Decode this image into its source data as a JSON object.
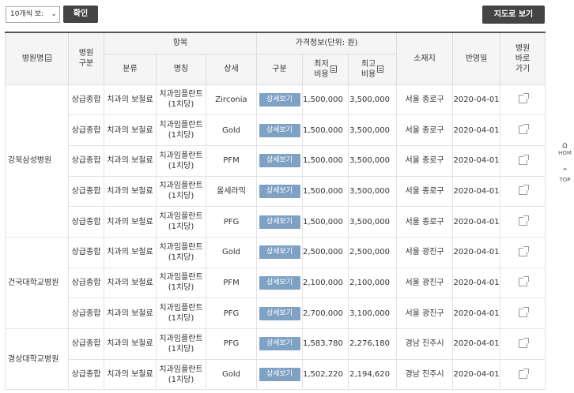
{
  "toolbar": {
    "page_size_value": "10개씩 보:",
    "confirm_label": "확인",
    "map_label": "지도로 보기"
  },
  "headers": {
    "hospital": "병원명",
    "hospital_type": "병원\n구분",
    "item_group": "항목",
    "price_group": "가격정보(단위: 원)",
    "location": "소재지",
    "date": "반영일",
    "shortcut": "병원\n바로\n가기",
    "category": "분류",
    "name": "명칭",
    "detail": "상세",
    "type": "구분",
    "min_cost": "최저\n비용",
    "max_cost": "최고\n비용"
  },
  "hospitals": [
    {
      "name": "강북삼성병원",
      "rows": [
        {
          "type": "상급종합",
          "category": "치과의 보철료",
          "item": "치과임플란트\n(1치당)",
          "detail": "Zirconia",
          "btn": "상세보기",
          "min": "1,500,000",
          "max": "3,500,000",
          "loc": "서울 종로구",
          "date": "2020-04-01"
        },
        {
          "type": "상급종합",
          "category": "치과의 보철료",
          "item": "치과임플란트\n(1치당)",
          "detail": "Gold",
          "btn": "상세보기",
          "min": "1,500,000",
          "max": "3,500,000",
          "loc": "서울 종로구",
          "date": "2020-04-01"
        },
        {
          "type": "상급종합",
          "category": "치과의 보철료",
          "item": "치과임플란트\n(1치당)",
          "detail": "PFM",
          "btn": "상세보기",
          "min": "1,500,000",
          "max": "3,500,000",
          "loc": "서울 종로구",
          "date": "2020-04-01"
        },
        {
          "type": "상급종합",
          "category": "치과의 보철료",
          "item": "치과임플란트\n(1치당)",
          "detail": "올세라믹",
          "btn": "상세보기",
          "min": "1,500,000",
          "max": "3,500,000",
          "loc": "서울 종로구",
          "date": "2020-04-01"
        },
        {
          "type": "상급종합",
          "category": "치과의 보철료",
          "item": "치과임플란트\n(1치당)",
          "detail": "PFG",
          "btn": "상세보기",
          "min": "1,500,000",
          "max": "3,500,000",
          "loc": "서울 종로구",
          "date": "2020-04-01"
        }
      ]
    },
    {
      "name": "건국대학교병원",
      "rows": [
        {
          "type": "상급종합",
          "category": "치과의 보철료",
          "item": "치과임플란트\n(1치당)",
          "detail": "Gold",
          "btn": "상세보기",
          "min": "2,500,000",
          "max": "2,500,000",
          "loc": "서울 광진구",
          "date": "2020-04-01"
        },
        {
          "type": "상급종합",
          "category": "치과의 보철료",
          "item": "치과임플란트\n(1치당)",
          "detail": "PFM",
          "btn": "상세보기",
          "min": "2,100,000",
          "max": "2,100,000",
          "loc": "서울 광진구",
          "date": "2020-04-01"
        },
        {
          "type": "상급종합",
          "category": "치과의 보철료",
          "item": "치과임플란트\n(1치당)",
          "detail": "PFG",
          "btn": "상세보기",
          "min": "2,700,000",
          "max": "3,100,000",
          "loc": "서울 광진구",
          "date": "2020-04-01"
        }
      ]
    },
    {
      "name": "경상대학교병원",
      "rows": [
        {
          "type": "상급종합",
          "category": "치과의 보철료",
          "item": "치과임플란트\n(1치당)",
          "detail": "PFG",
          "btn": "상세보기",
          "min": "1,583,780",
          "max": "2,276,180",
          "loc": "경남 진주시",
          "date": "2020-04-01"
        },
        {
          "type": "상급종합",
          "category": "치과의 보철료",
          "item": "치과임플란트\n(1치당)",
          "detail": "Gold",
          "btn": "상세보기",
          "min": "1,502,220",
          "max": "2,194,620",
          "loc": "경남 진주시",
          "date": "2020-04-01"
        }
      ]
    }
  ],
  "side": {
    "home": "HOM",
    "top": "TOP"
  }
}
